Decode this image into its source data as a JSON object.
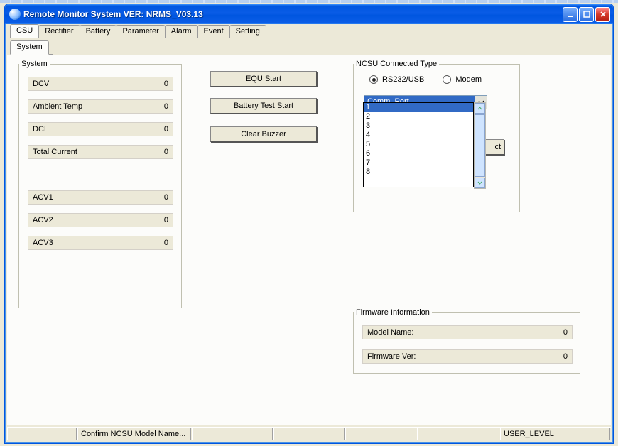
{
  "title": "Remote Monitor System   VER: NRMS_V03.13",
  "tabs_main": [
    "CSU",
    "Rectifier",
    "Battery",
    "Parameter",
    "Alarm",
    "Event",
    "Setting"
  ],
  "active_main_tab": 0,
  "tabs_sub": [
    "System"
  ],
  "system": {
    "legend": "System",
    "rows_top": [
      {
        "label": "DCV",
        "value": "0"
      },
      {
        "label": "Ambient Temp",
        "value": "0"
      },
      {
        "label": "DCI",
        "value": "0"
      },
      {
        "label": "Total Current",
        "value": "0"
      }
    ],
    "rows_bottom": [
      {
        "label": "ACV1",
        "value": "0"
      },
      {
        "label": "ACV2",
        "value": "0"
      },
      {
        "label": "ACV3",
        "value": "0"
      }
    ]
  },
  "buttons": {
    "equ_start": "EQU Start",
    "batt_test": "Battery Test Start",
    "clear_buzzer": "Clear Buzzer"
  },
  "ncsu": {
    "legend": "NCSU Connected Type",
    "radio1": "RS232/USB",
    "radio2": "Modem",
    "radio_selected": 1,
    "comm_label": "Comm. Port",
    "options": [
      "1",
      "2",
      "3",
      "4",
      "5",
      "6",
      "7",
      "8"
    ],
    "highlight_index": 0,
    "hidden_btn_tail": "ct"
  },
  "fw": {
    "legend": "Firmware Information",
    "model_label": "Model Name:",
    "model_value": "0",
    "ver_label": "Firmware Ver:",
    "ver_value": "0"
  },
  "status": {
    "msg": "Confirm NCSU Model Name...",
    "level": "USER_LEVEL"
  }
}
